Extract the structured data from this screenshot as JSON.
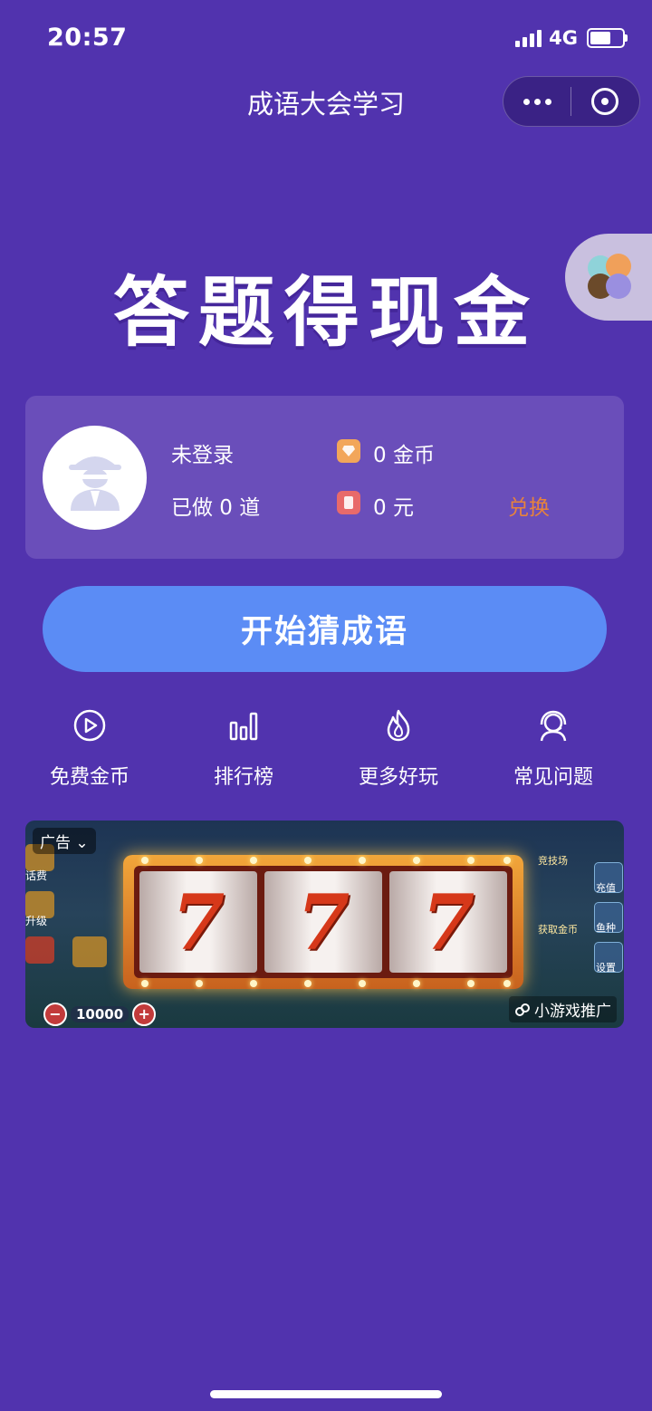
{
  "status_bar": {
    "time": "20:57",
    "network": "4G"
  },
  "nav": {
    "title": "成语大会学习"
  },
  "hero": {
    "title": "答题得现金"
  },
  "user_card": {
    "login_status": "未登录",
    "answered_label": "已做 0 道",
    "coins_label": "0 金币",
    "cash_label": "0 元",
    "exchange_label": "兑换"
  },
  "start_button": {
    "label": "开始猜成语"
  },
  "menu": [
    {
      "label": "免费金币",
      "icon": "play-circle-icon"
    },
    {
      "label": "排行榜",
      "icon": "bar-chart-icon"
    },
    {
      "label": "更多好玩",
      "icon": "fire-icon"
    },
    {
      "label": "常见问题",
      "icon": "headset-icon"
    }
  ],
  "ad": {
    "tag": "广告",
    "promo": "小游戏推广",
    "reels": [
      "7",
      "7",
      "7"
    ],
    "bet_value": "10000",
    "left_labels": [
      "话费",
      "升级"
    ],
    "right_labels": [
      "充值",
      "鱼种",
      "设置"
    ],
    "right_top_labels": [
      "竞技场",
      "获取金币"
    ]
  },
  "colors": {
    "background": "#5133AE",
    "card": "#6A4EBA",
    "button": "#5B8CF5",
    "exchange": "#E8833B"
  }
}
